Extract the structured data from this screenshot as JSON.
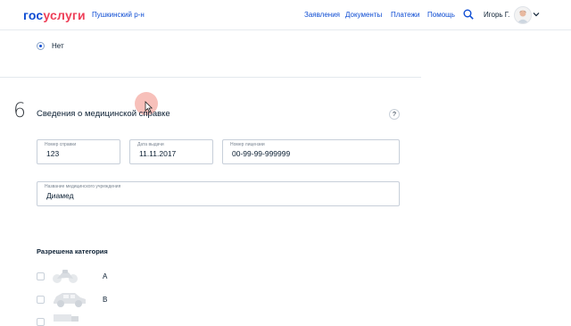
{
  "header": {
    "logo_gos": "гос",
    "logo_uslugi": "услуги",
    "region": "Пушкинский р-н",
    "nav": [
      "Заявления",
      "Документы",
      "Платежи",
      "Помощь"
    ],
    "user_name": "Игорь Г."
  },
  "radio": {
    "label": "Нет"
  },
  "section": {
    "number": "6",
    "title": "Сведения о медицинской справке",
    "help": "?"
  },
  "fields": {
    "certificate_number": {
      "label": "Номер справки",
      "value": "123"
    },
    "issue_date": {
      "label": "Дата выдачи",
      "value": "11.11.2017"
    },
    "license_number": {
      "label": "Номер лицензии",
      "value": "00-99-99-999999"
    },
    "institution": {
      "label": "Название медицинского учреждения",
      "value": "Диамед"
    }
  },
  "categories": {
    "title": "Разрешена категория",
    "items": [
      {
        "letter": "A",
        "icon": "motorcycle-icon"
      },
      {
        "letter": "B",
        "icon": "car-icon"
      },
      {
        "letter": "",
        "icon": "truck-icon"
      }
    ]
  },
  "colors": {
    "brand_blue": "#0d4cd3",
    "brand_red": "#ee3f58",
    "text": "#0b1f33"
  }
}
